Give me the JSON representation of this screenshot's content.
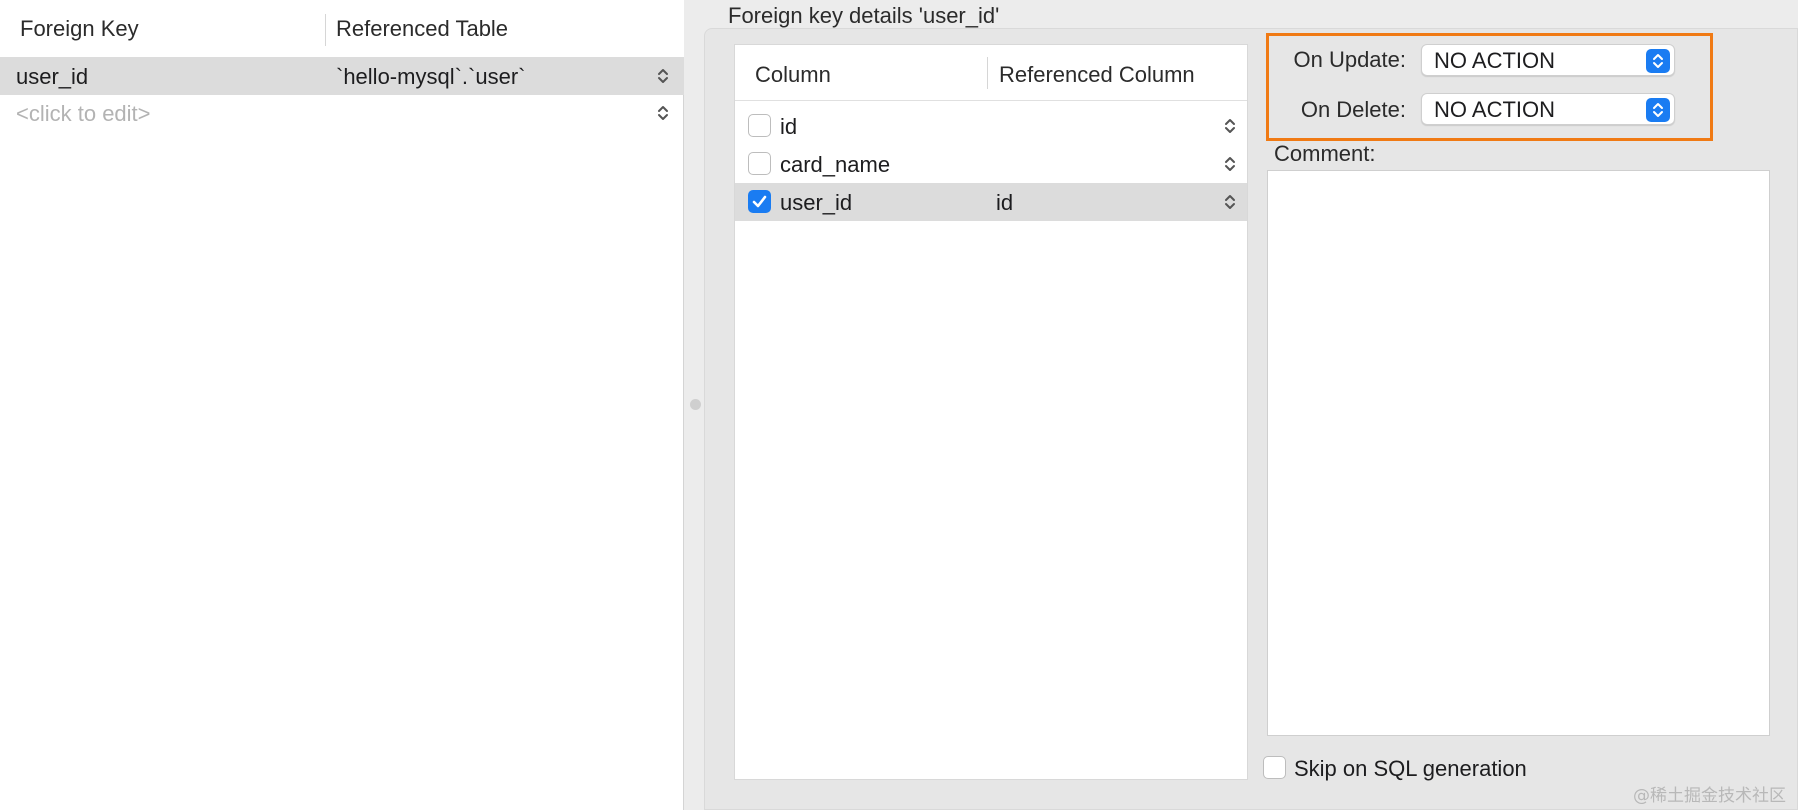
{
  "left_table": {
    "headers": [
      "Foreign Key",
      "Referenced Table"
    ],
    "rows": [
      {
        "key": "user_id",
        "table": "`hello-mysql`.`user`"
      }
    ],
    "placeholder": "<click to edit>"
  },
  "details": {
    "title": "Foreign key details 'user_id'",
    "columns_table": {
      "headers": [
        "Column",
        "Referenced Column"
      ],
      "rows": [
        {
          "name": "id",
          "ref": "",
          "checked": false
        },
        {
          "name": "card_name",
          "ref": "",
          "checked": false
        },
        {
          "name": "user_id",
          "ref": "id",
          "checked": true
        }
      ]
    },
    "on_update": {
      "label": "On Update:",
      "value": "NO ACTION"
    },
    "on_delete": {
      "label": "On Delete:",
      "value": "NO ACTION"
    },
    "comment": {
      "label": "Comment:",
      "value": ""
    },
    "skip": {
      "label": "Skip on SQL generation",
      "checked": false
    }
  },
  "watermark": "@稀土掘金技术社区",
  "colors": {
    "accent": "#1a7cf2",
    "highlight": "#f07a14",
    "selected_row": "#dcdcdc"
  }
}
